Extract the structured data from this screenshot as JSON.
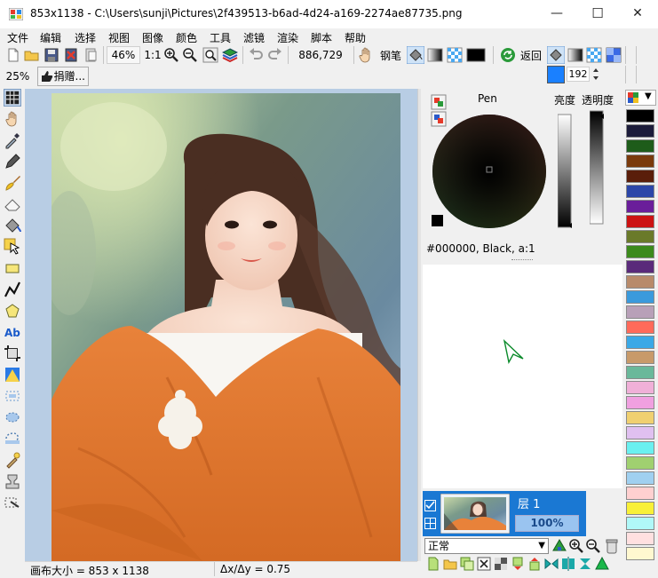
{
  "window": {
    "title": "853x1138 - C:\\Users\\sunji\\Pictures\\2f439513-b6ad-4d24-a169-2274ae87735.png",
    "minimize": "—",
    "maximize": "☐",
    "close": "✕"
  },
  "menu": [
    "文件",
    "编辑",
    "选择",
    "视图",
    "图像",
    "颜色",
    "工具",
    "滤镜",
    "渲染",
    "脚本",
    "帮助"
  ],
  "toolbar": {
    "zoom": "46%",
    "ratio": "1:1",
    "pixels": "886,729",
    "tool_name": "钢笔",
    "back_label": "返回",
    "width_value": "192"
  },
  "toolbar2": {
    "zoom_small": "25%",
    "donate_label": "捐赠..."
  },
  "color_panel": {
    "tool_label": "Pen",
    "brightness_label": "亮度",
    "opacity_label": "透明度",
    "color_readout": "#000000, Black, a:1"
  },
  "layer": {
    "name": "层 1",
    "opacity": "100%",
    "blend_mode": "正常"
  },
  "status": {
    "canvas_size": "画布大小 = 853 x 1138",
    "delta": "Δx/Δy = 0.75"
  },
  "palette_colors": [
    "#000000",
    "#1c1c3a",
    "#1e5c1a",
    "#7a3a0c",
    "#5a1e0a",
    "#2c46a8",
    "#6a1e9a",
    "#cc1212",
    "#6a7a2a",
    "#3c8a1c",
    "#5a2a7a",
    "#b88a6a",
    "#3a9adc",
    "#b8a0b8",
    "#ff6a5a",
    "#3aa8e6",
    "#c89a6a",
    "#6ab89a",
    "#f0b0d8",
    "#f0a0e0",
    "#f0d070",
    "#e0c0f0",
    "#6af0f0",
    "#a0d070",
    "#a0d0f0",
    "#ffd0d0",
    "#f8f038",
    "#b0f8f8",
    "#ffe0e0",
    "#fff8d0"
  ],
  "colors": {
    "accent": "#1a78d3",
    "selected_primary": "#1a80ff"
  }
}
